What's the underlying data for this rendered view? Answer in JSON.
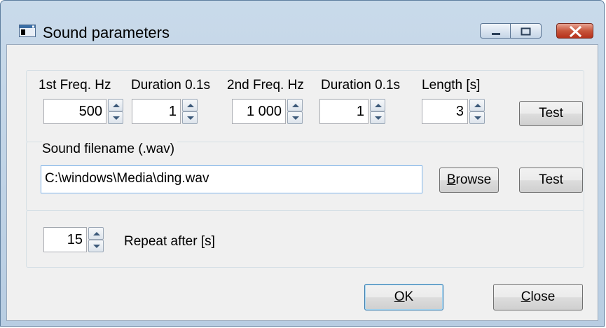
{
  "window": {
    "title": "Sound parameters",
    "icon": "app-window-icon",
    "controls": {
      "minimize": "minimize-icon",
      "maximize": "maximize-icon",
      "close": "close-icon"
    }
  },
  "tone": {
    "freq1": {
      "label": "1st Freq. Hz",
      "value": "500"
    },
    "dur1": {
      "label": "Duration 0.1s",
      "value": "1"
    },
    "freq2": {
      "label": "2nd Freq. Hz",
      "value": "1 000"
    },
    "dur2": {
      "label": "Duration 0.1s",
      "value": "1"
    },
    "length": {
      "label": "Length [s]",
      "value": "3"
    },
    "test_label": "Test"
  },
  "file": {
    "label": "Sound filename (.wav)",
    "value": "C:\\windows\\Media\\ding.wav",
    "browse_accel": "B",
    "browse_rest": "rowse",
    "test_label": "Test"
  },
  "repeat": {
    "value": "15",
    "label": "Repeat after [s]"
  },
  "footer": {
    "ok_accel": "O",
    "ok_rest": "K",
    "close_accel": "C",
    "close_rest": "lose"
  },
  "colors": {
    "titlebar": "#c9daea",
    "client": "#f0f0f0",
    "close_red": "#c8553b",
    "focus_border": "#3c7fb1"
  }
}
